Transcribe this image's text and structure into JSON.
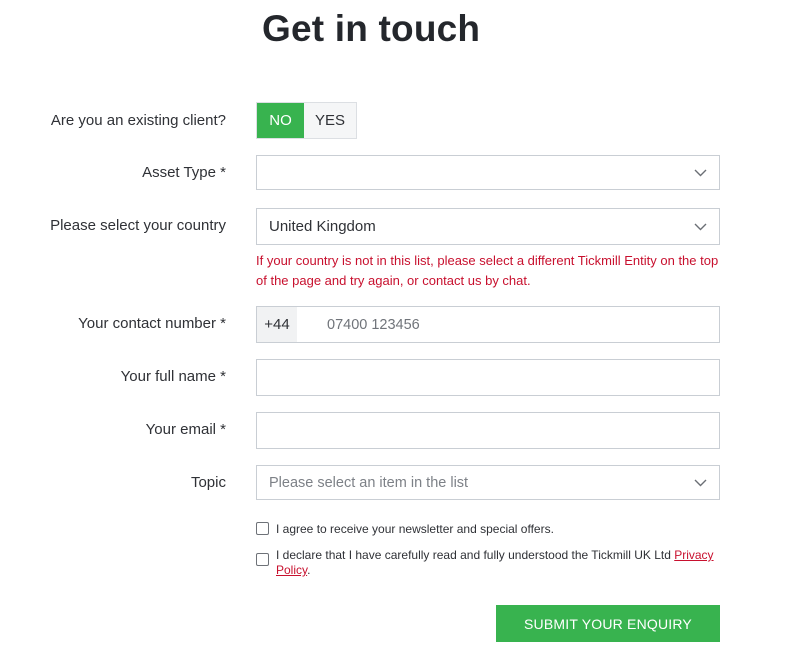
{
  "page": {
    "title": "Get in touch"
  },
  "form": {
    "existing_client": {
      "label": "Are you an existing client?",
      "options": [
        "NO",
        "YES"
      ],
      "selected": "NO"
    },
    "asset_type": {
      "label": "Asset Type *",
      "value": ""
    },
    "country": {
      "label": "Please select your country",
      "value": "United Kingdom",
      "note": "If your country is not in this list, please select a different Tickmill Entity on the top of the page and try again, or contact us by chat."
    },
    "contact_number": {
      "label": "Your contact number *",
      "prefix": "+44",
      "placeholder": "07400 123456",
      "value": ""
    },
    "full_name": {
      "label": "Your full name *",
      "value": ""
    },
    "email": {
      "label": "Your email *",
      "value": ""
    },
    "topic": {
      "label": "Topic",
      "placeholder": "Please select an item in the list"
    },
    "newsletter": {
      "label": "I agree to receive your newsletter and special offers.",
      "checked": false
    },
    "privacy": {
      "label": "I declare that I have carefully read and fully understood the Tickmill UK Ltd ",
      "link_text": "Privacy Policy",
      "suffix": ".",
      "checked": false
    },
    "submit_label": "SUBMIT YOUR ENQUIRY"
  },
  "colors": {
    "accent_green": "#38b34f",
    "error_red": "#c8102e"
  }
}
